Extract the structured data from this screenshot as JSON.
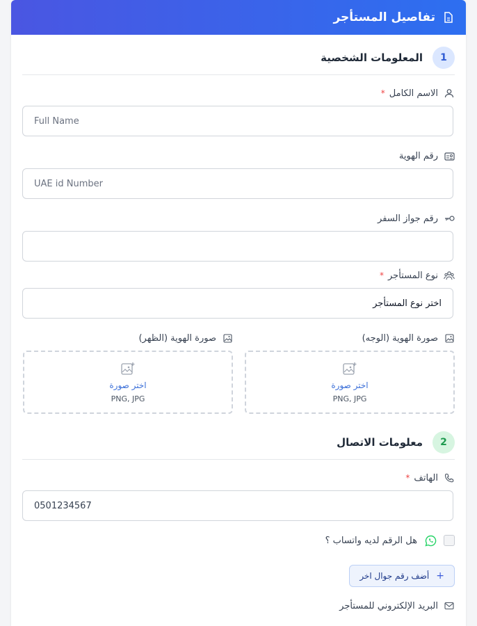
{
  "header": {
    "title": "تفاصيل المستأجر",
    "icon": "document-icon"
  },
  "sections": [
    {
      "number": "1",
      "title": "المعلومات الشخصية"
    },
    {
      "number": "2",
      "title": "معلومات الاتصال"
    }
  ],
  "fields": {
    "full_name": {
      "label": "الاسم الكامل",
      "required": "*",
      "placeholder": "Full Name"
    },
    "id_number": {
      "label": "رقم الهوية",
      "placeholder": "UAE id Number"
    },
    "passport": {
      "label": "رقم جواز السفر",
      "placeholder": ""
    },
    "tenant_type": {
      "label": "نوع المستأجر",
      "required": "*",
      "selected": "اختر نوع المستأجر"
    },
    "phone": {
      "label": "الهاتف",
      "required": "*",
      "value": "0501234567"
    },
    "email": {
      "label": "البريد الإلكتروني للمستأجر"
    }
  },
  "uploads": {
    "front": {
      "label": "صورة الهوية (الوجه)",
      "choose": "اختر صورة",
      "types": "PNG, JPG"
    },
    "back": {
      "label": "صورة الهوية (الظهر)",
      "choose": "اختر صورة",
      "types": "PNG, JPG"
    }
  },
  "whatsapp": {
    "question": "هل الرقم لديه واتساب ؟"
  },
  "add_phone": {
    "label": "أضف رقم جوال اخر",
    "icon": "+"
  },
  "colors": {
    "header_start": "#4a56e2",
    "header_end": "#2d6ff0",
    "required": "#ef4444",
    "link": "#3b6fd8",
    "whatsapp": "#25d366"
  }
}
